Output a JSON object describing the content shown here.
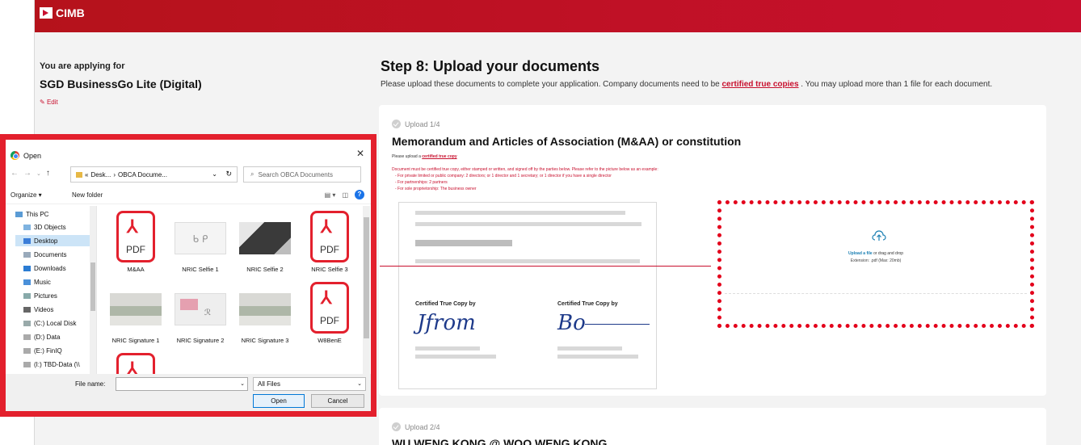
{
  "brand": {
    "name": "CIMB",
    "color": "#c8102e"
  },
  "left_panel": {
    "applying_label": "You are applying for",
    "product": "SGD BusinessGo Lite (Digital)",
    "edit": "Edit"
  },
  "main": {
    "step_title": "Step 8: Upload your documents",
    "desc_before": "Please upload these documents to complete your application. Company documents need to be ",
    "desc_link": "certified true copies",
    "desc_after": " . You may upload more than 1 file for each document."
  },
  "card1": {
    "step": "Upload 1/4",
    "title": "Memorandum and Articles of Association (M&AA) or constitution",
    "hint_before": "Please upload a ",
    "hint_link": "certified true copy",
    "rules": [
      "Document must be certified true copy, either stamped or written, and signed off by the parties below. Please refer to the picture below as an example:",
      "- For private limited or public company: 2 directors; or 1 director and 1 secretary; or 1 director if you have a single director",
      "- For partnerships: 2 partners",
      "- For sole proprietorship: The business owner"
    ],
    "sample": {
      "ctc_label_1": "Certified True Copy by",
      "ctc_label_2": "Certified True Copy by",
      "sig_1": "Jfrom",
      "sig_2": "Bo"
    },
    "dropzone": {
      "link": "Upload a file",
      "text": " or drag and drop",
      "ext": "Extension: .pdf (Max: 20mb)"
    }
  },
  "card2": {
    "step": "Upload 2/4",
    "title": "WU WENG KONG @ WOO WENG KONG"
  },
  "dialog": {
    "title": "Open",
    "path": [
      "«",
      "Desk...",
      "›",
      "OBCA Docume..."
    ],
    "search_placeholder": "Search OBCA Documents",
    "organize": "Organize ▾",
    "new_folder": "New folder",
    "nav_items": [
      {
        "label": "This PC",
        "icon": "pc-icon"
      },
      {
        "label": "3D Objects",
        "icon": "cube-icon"
      },
      {
        "label": "Desktop",
        "icon": "desktop-icon",
        "selected": true
      },
      {
        "label": "Documents",
        "icon": "documents-icon"
      },
      {
        "label": "Downloads",
        "icon": "download-icon"
      },
      {
        "label": "Music",
        "icon": "music-icon"
      },
      {
        "label": "Pictures",
        "icon": "pictures-icon"
      },
      {
        "label": "Videos",
        "icon": "videos-icon"
      },
      {
        "label": "(C:) Local Disk",
        "icon": "drive-icon"
      },
      {
        "label": "(D:) Data",
        "icon": "drive-icon"
      },
      {
        "label": "(E:) FinIQ",
        "icon": "drive-icon"
      },
      {
        "label": "(I:) TBD-Data (\\\\",
        "icon": "network-drive-icon"
      }
    ],
    "files": [
      {
        "name": "M&AA",
        "type": "pdf"
      },
      {
        "name": "NRIC Selfie 1",
        "type": "photo-sketch"
      },
      {
        "name": "NRIC Selfie 2",
        "type": "photo-dark"
      },
      {
        "name": "NRIC Selfie 3",
        "type": "pdf"
      },
      {
        "name": "NRIC Signature 1",
        "type": "photo-card"
      },
      {
        "name": "NRIC Signature 2",
        "type": "photo-pink"
      },
      {
        "name": "NRIC Signature 3",
        "type": "photo-card"
      },
      {
        "name": "W8BenE",
        "type": "pdf"
      },
      {
        "name": "",
        "type": "pdf"
      }
    ],
    "file_name_label": "File name:",
    "file_name_value": "",
    "file_type": "All Files",
    "open_button": "Open",
    "cancel_button": "Cancel",
    "pdf_text": "PDF"
  }
}
